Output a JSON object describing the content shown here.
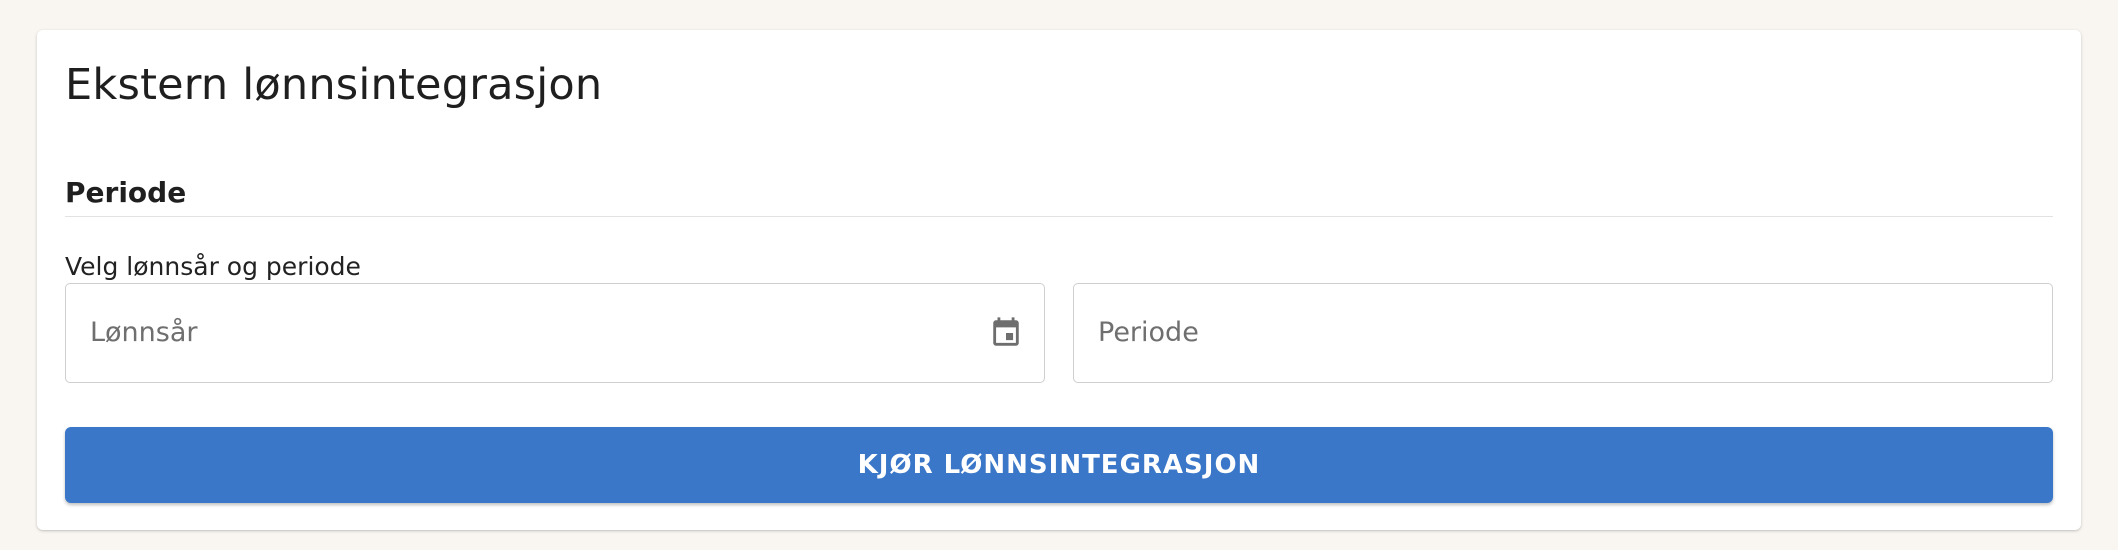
{
  "card": {
    "title": "Ekstern lønnsintegrasjon"
  },
  "period_section": {
    "heading": "Periode",
    "helper": "Velg lønnsår og periode"
  },
  "fields": {
    "year": {
      "placeholder": "Lønnsår",
      "value": "",
      "icon": "calendar-icon"
    },
    "period": {
      "placeholder": "Periode",
      "value": ""
    }
  },
  "actions": {
    "run_label": "KJØR LØNNSINTEGRASJON"
  },
  "colors": {
    "page_background": "#f9f6f2",
    "card_background": "#ffffff",
    "primary_button": "#3a77c8",
    "icon": "#6e6e6e",
    "placeholder_text": "#6f6f6f"
  }
}
